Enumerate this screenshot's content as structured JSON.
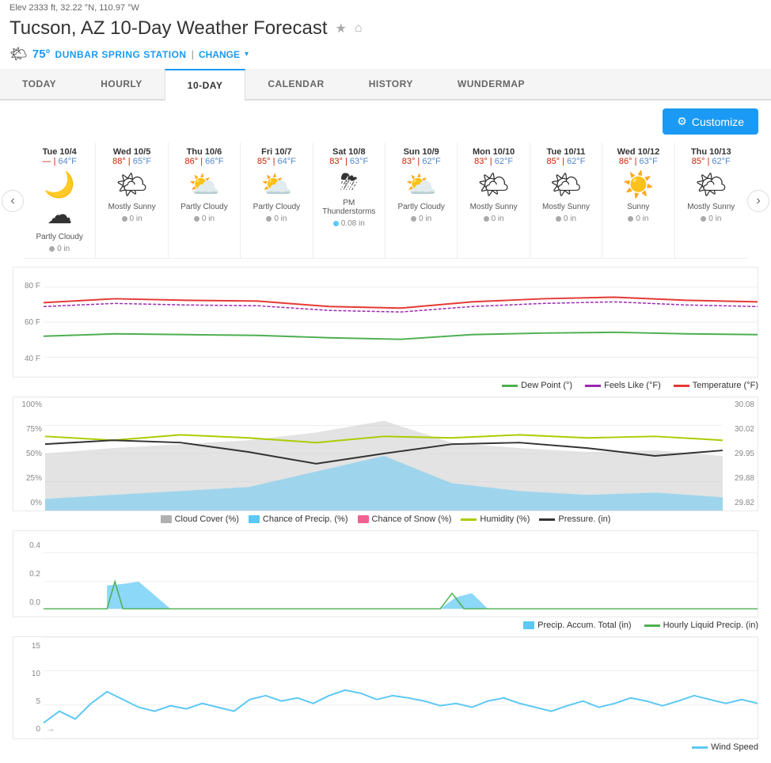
{
  "meta": {
    "elevation": "Elev 2333 ft, 32.22 °N, 110.97 °W",
    "title": "Tucson, AZ 10-Day Weather Forecast",
    "star_label": "★",
    "home_label": "⌂",
    "temp": "75°",
    "station": "DUNBAR SPRING STATION",
    "separator": "|",
    "change": "CHANGE",
    "dropdown": "▾"
  },
  "nav": {
    "tabs": [
      {
        "label": "TODAY",
        "active": false
      },
      {
        "label": "HOURLY",
        "active": false
      },
      {
        "label": "10-DAY",
        "active": true
      },
      {
        "label": "CALENDAR",
        "active": false
      },
      {
        "label": "HISTORY",
        "active": false
      },
      {
        "label": "WUNDERMAP",
        "active": false
      }
    ]
  },
  "toolbar": {
    "customize_label": "Customize",
    "gear": "⚙"
  },
  "forecast": {
    "days": [
      {
        "date": "Tue 10/4",
        "hi": "—",
        "lo": "64°F",
        "desc": "Partly Cloudy",
        "emoji": "🌙☁",
        "precip": "0 in",
        "has_rain": false
      },
      {
        "date": "Wed 10/5",
        "hi": "88°",
        "lo": "65°F",
        "desc": "Mostly Sunny",
        "emoji": "🌤",
        "precip": "0 in",
        "has_rain": false
      },
      {
        "date": "Thu 10/6",
        "hi": "86°",
        "lo": "66°F",
        "desc": "Partly Cloudy",
        "emoji": "⛅",
        "precip": "0 in",
        "has_rain": false
      },
      {
        "date": "Fri 10/7",
        "hi": "85°",
        "lo": "64°F",
        "desc": "Partly Cloudy",
        "emoji": "⛅",
        "precip": "0 in",
        "has_rain": false
      },
      {
        "date": "Sat 10/8",
        "hi": "83°",
        "lo": "63°F",
        "desc": "PM Thunderstorms",
        "emoji": "⛈",
        "precip": "0.08 in",
        "has_rain": true
      },
      {
        "date": "Sun 10/9",
        "hi": "83°",
        "lo": "62°F",
        "desc": "Partly Cloudy",
        "emoji": "⛅",
        "precip": "0 in",
        "has_rain": false
      },
      {
        "date": "Mon 10/10",
        "hi": "83°",
        "lo": "62°F",
        "desc": "Mostly Sunny",
        "emoji": "🌤",
        "precip": "0 in",
        "has_rain": false
      },
      {
        "date": "Tue 10/11",
        "hi": "85°",
        "lo": "62°F",
        "desc": "Mostly Sunny",
        "emoji": "🌤",
        "precip": "0 in",
        "has_rain": false
      },
      {
        "date": "Wed 10/12",
        "hi": "86°",
        "lo": "63°F",
        "desc": "Sunny",
        "emoji": "☀️",
        "precip": "0 in",
        "has_rain": false
      },
      {
        "date": "Thu 10/13",
        "hi": "85°",
        "lo": "62°F",
        "desc": "Mostly Sunny",
        "emoji": "🌤",
        "precip": "0 in",
        "has_rain": false
      }
    ]
  },
  "chart_legends": {
    "temp": [
      {
        "label": "Dew Point (°)",
        "color": "green"
      },
      {
        "label": "Feels Like (°F)",
        "color": "purple"
      },
      {
        "label": "Temperature (°F)",
        "color": "red"
      }
    ],
    "precip": [
      {
        "label": "Cloud Cover (%)",
        "color": "#b0b0b0"
      },
      {
        "label": "Chance of Precip. (%)",
        "color": "#5bc8f5"
      },
      {
        "label": "Chance of Snow (%)",
        "color": "#f06292"
      },
      {
        "label": "Humidity (%)",
        "color": "#aacc00"
      },
      {
        "label": "Pressure. (in)",
        "color": "#333333"
      }
    ],
    "accum": [
      {
        "label": "Precip. Accum. Total (in)",
        "color": "#5bc8f5"
      },
      {
        "label": "Hourly Liquid Precip. (in)",
        "color": "#4caf50"
      }
    ],
    "wind": [
      {
        "label": "Wind Speed",
        "color": "#5bc8f5"
      }
    ]
  },
  "chart_axes": {
    "temp_left": [
      "80 F",
      "60 F",
      "40 F"
    ],
    "precip_left": [
      "100%",
      "75%",
      "50%",
      "25%",
      "0%"
    ],
    "precip_right": [
      "30.08",
      "30.02",
      "29.95",
      "29.88",
      "29.82"
    ],
    "accum_left": [
      "0.4",
      "0.2",
      "0.0"
    ],
    "wind_left": [
      "15",
      "10",
      "5",
      "0"
    ]
  }
}
